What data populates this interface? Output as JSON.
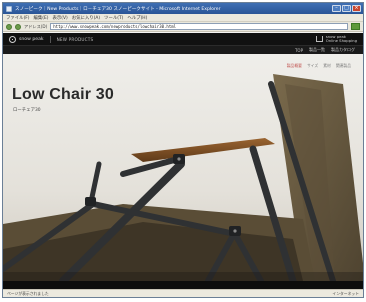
{
  "browser": {
    "title": "スノーピーク｜New Products｜ロ－チェア30 スノーピークサイト - Microsoft Internet Explorer",
    "menu": [
      "ファイル(F)",
      "編集(E)",
      "表示(V)",
      "お気に入り(A)",
      "ツール(T)",
      "ヘルプ(H)"
    ],
    "address_label": "アドレス(D)",
    "address_value": "http://www.snowpeak.com/newproducts/lowchair30.html",
    "status_left": "ページが表示されました",
    "status_right": "インターネット"
  },
  "site": {
    "logo_text": "snow peak",
    "section_label": "NEW PRODUCTS",
    "online_store": [
      "snow peak",
      "Online Shopping"
    ],
    "subnav": [
      "TOP",
      "製品一覧",
      "製品カタログ"
    ]
  },
  "page": {
    "breadcrumb": [
      "製品概要",
      "サイズ",
      "素材",
      "関連製品"
    ],
    "title": "Low Chair 30",
    "subtitle": "ローチェア30"
  },
  "colors": {
    "accent": "#c0504d",
    "seat_fabric": "#6a5a40",
    "frame": "#2f3133",
    "armrest_wood": "#7a4b22"
  },
  "icons": [
    "app-icon",
    "back-icon",
    "forward-icon",
    "go-icon",
    "logo-mark",
    "cart-icon"
  ]
}
